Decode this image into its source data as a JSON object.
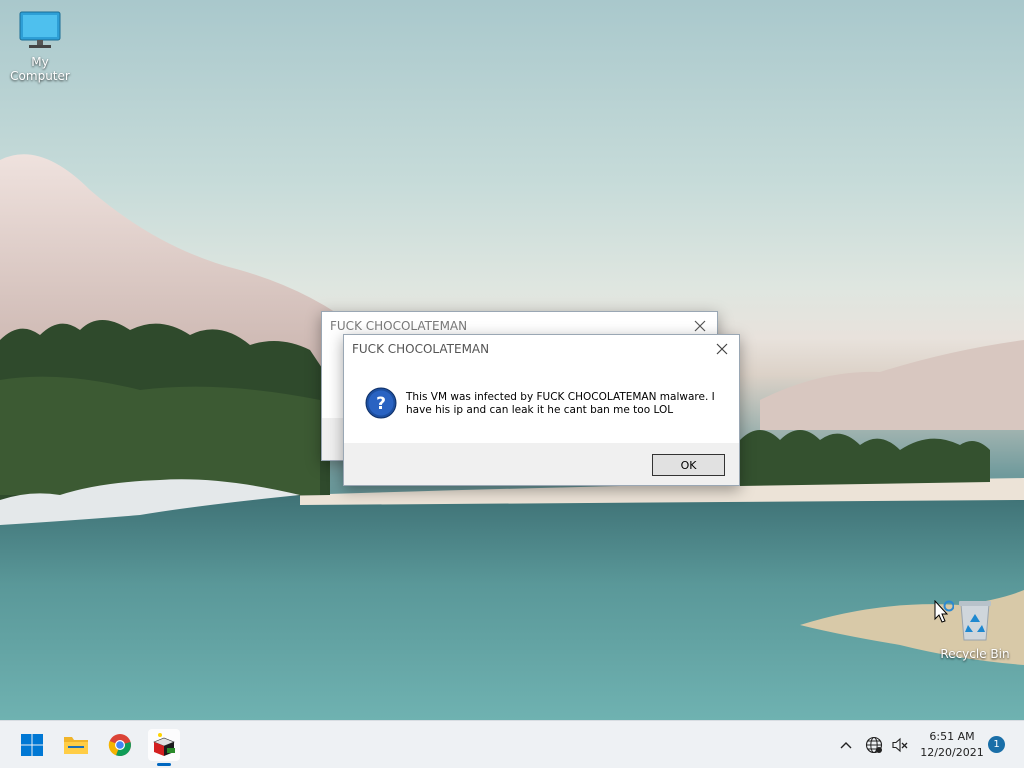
{
  "desktop": {
    "icons": [
      {
        "label": "My Computer",
        "icon": "computer-icon"
      },
      {
        "label": "Recycle Bin",
        "icon": "recycle-bin-icon"
      }
    ]
  },
  "dialogs": {
    "back": {
      "title": "FUCK CHOCOLATEMAN"
    },
    "front": {
      "title": "FUCK CHOCOLATEMAN",
      "message": "This VM was infected by FUCK CHOCOLATEMAN malware. I have his ip and can leak it he cant ban me too LOL",
      "icon": "question-icon",
      "ok_label": "OK"
    }
  },
  "taskbar": {
    "apps": [
      {
        "name": "start",
        "icon": "windows-logo-icon"
      },
      {
        "name": "file-explorer",
        "icon": "folder-icon"
      },
      {
        "name": "chrome",
        "icon": "chrome-icon"
      },
      {
        "name": "malware-app",
        "icon": "cube-app-icon",
        "active": true
      }
    ],
    "tray": {
      "chevron": "chevron-up-icon",
      "network": "globe-icon",
      "volume": "speaker-muted-icon"
    },
    "clock": {
      "time": "6:51 AM",
      "date": "12/20/2021"
    },
    "notification_count": "1"
  },
  "colors": {
    "accent": "#0067c0",
    "taskbar_bg": "#eef1f4",
    "dialog_footer": "#f0f0f0"
  }
}
